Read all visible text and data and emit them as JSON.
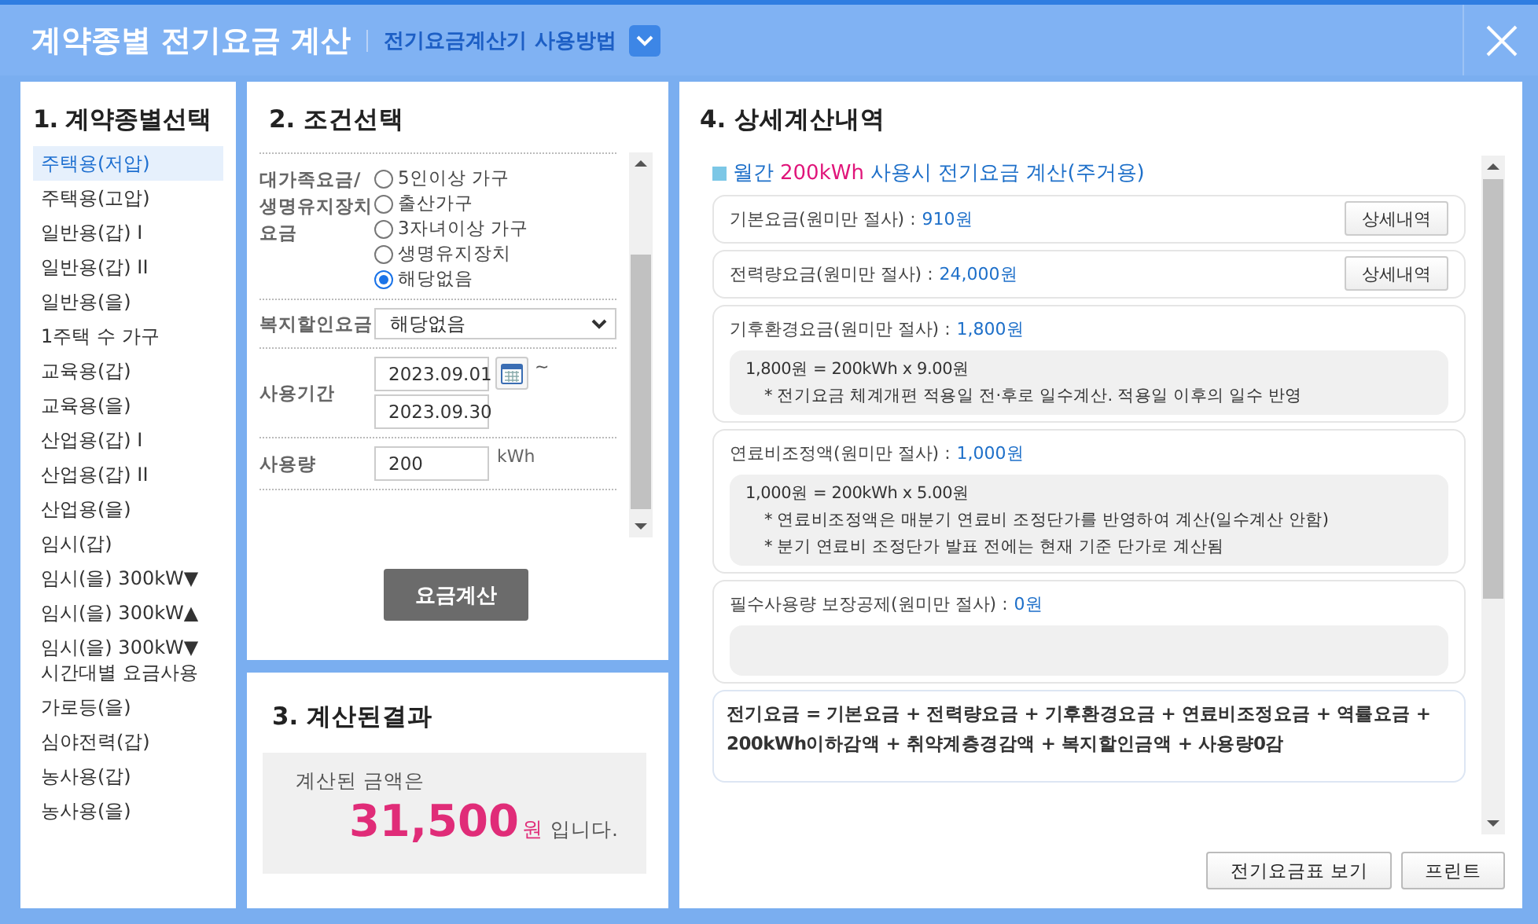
{
  "window": {
    "title": "계약종별 전기요금 계산",
    "help_link": "전기요금계산기 사용방법"
  },
  "contract_types": {
    "heading": "1. 계약종별선택",
    "items": [
      {
        "label": "주택용(저압)",
        "selected": true
      },
      {
        "label": "주택용(고압)",
        "selected": false
      },
      {
        "label": "일반용(갑) I",
        "selected": false
      },
      {
        "label": "일반용(갑) II",
        "selected": false
      },
      {
        "label": "일반용(을)",
        "selected": false
      },
      {
        "label": "1주택 수 가구",
        "selected": false
      },
      {
        "label": "교육용(갑)",
        "selected": false
      },
      {
        "label": "교육용(을)",
        "selected": false
      },
      {
        "label": "산업용(갑) I",
        "selected": false
      },
      {
        "label": "산업용(갑) II",
        "selected": false
      },
      {
        "label": "산업용(을)",
        "selected": false
      },
      {
        "label": "임시(갑)",
        "selected": false
      },
      {
        "label": "임시(을) 300kW▼",
        "selected": false
      },
      {
        "label": "임시(을) 300kW▲",
        "selected": false
      },
      {
        "label": "임시(을) 300kW▼ 시간대별 요금사용",
        "selected": false
      },
      {
        "label": "가로등(을)",
        "selected": false
      },
      {
        "label": "심야전력(갑)",
        "selected": false
      },
      {
        "label": "농사용(갑)",
        "selected": false
      },
      {
        "label": "농사용(을)",
        "selected": false
      }
    ]
  },
  "conditions": {
    "heading": "2. 조건선택",
    "rows": [
      {
        "kind": "radio",
        "label": "대가족요금/생명유지장치요금",
        "options": [
          {
            "label": "5인이상 가구",
            "selected": false
          },
          {
            "label": "출산가구",
            "selected": false
          },
          {
            "label": "3자녀이상 가구",
            "selected": false
          },
          {
            "label": "생명유지장치",
            "selected": false
          },
          {
            "label": "해당없음",
            "selected": true
          }
        ]
      },
      {
        "kind": "select",
        "label": "복지할인요금",
        "value": "해당없음"
      },
      {
        "kind": "dates",
        "label": "사용기간",
        "start": "2023.09.01",
        "end": "2023.09.30",
        "separator": "~"
      },
      {
        "kind": "number",
        "label": "사용량",
        "value": "200",
        "unit": "kWh"
      }
    ],
    "button": "요금계산"
  },
  "result": {
    "heading": "3. 계산된결과",
    "intro": "계산된 금액은",
    "amount": "31,500",
    "currency": "원",
    "suffix": "입니다."
  },
  "details": {
    "heading": "4. 상세계산내역",
    "summary_prefix": "월간",
    "summary_usage": "200kWh",
    "summary_suffix": "사용시 전기요금 계산(주거용)",
    "items": [
      {
        "kind": "button",
        "label": "기본요금(원미만 절사) :",
        "value": "910원",
        "button": "상세내역"
      },
      {
        "kind": "button",
        "label": "전력량요금(원미만 절사) :",
        "value": "24,000원",
        "button": "상세내역"
      },
      {
        "kind": "notes",
        "label": "기후환경요금(원미만 절사) :",
        "value": "1,800원",
        "lines": [
          {
            "kind": "formula",
            "text": "1,800원 = 200kWh x 9.00원"
          },
          {
            "kind": "note",
            "text": "* 전기요금 체계개편 적용일 전·후로 일수계산. 적용일 이후의 일수 반영"
          }
        ]
      },
      {
        "kind": "notes",
        "label": "연료비조정액(원미만 절사) :",
        "value": "1,000원",
        "lines": [
          {
            "kind": "formula",
            "text": "1,000원 = 200kWh x 5.00원"
          },
          {
            "kind": "note",
            "text": "* 연료비조정액은 매분기 연료비 조정단가를 반영하여 계산(일수계산 안함)"
          },
          {
            "kind": "note",
            "text": "* 분기 연료비 조정단가 발표 전에는 현재 기준 단가로 계산됨"
          }
        ]
      },
      {
        "kind": "notes",
        "label": "필수사용량 보장공제(원미만 절사) :",
        "value": "0원"
      }
    ],
    "formula": "전기요금 = 기본요금 + 전력량요금 + 기후환경요금 + 연료비조정요금 + 역률요금 + 200kWh이하감액 + 취약계층경감액 + 복지할인금액 + 사용량0감"
  },
  "footer_buttons": [
    "전기요금표 보기",
    "프린트"
  ]
}
